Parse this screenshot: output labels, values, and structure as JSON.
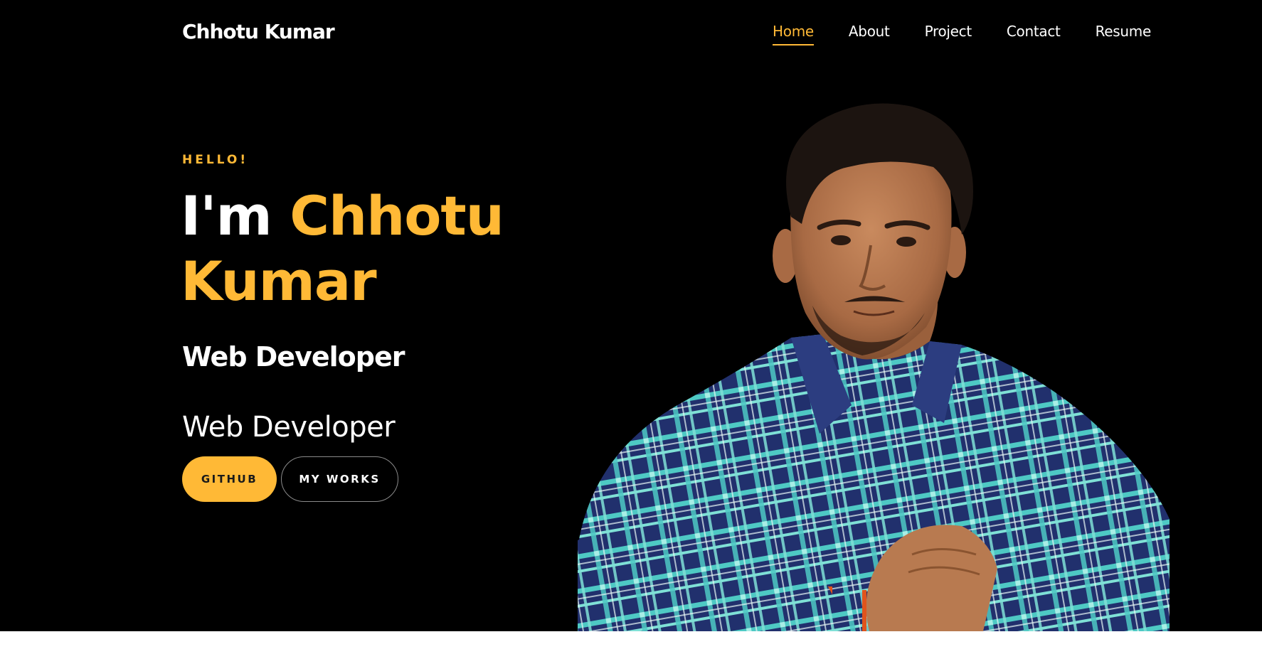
{
  "nav": {
    "brand": "Chhotu Kumar",
    "links": [
      "Home",
      "About",
      "Project",
      "Contact",
      "Resume"
    ],
    "active": "Home"
  },
  "hero": {
    "greeting": "HELLO!",
    "intro": "I'm",
    "first_name": "Chhotu",
    "last_name": "Kumar",
    "role": "Web Developer",
    "typed_role": "Web Developer"
  },
  "buttons": {
    "github": "GITHUB",
    "works": "MY WORKS"
  },
  "colors": {
    "background": "#000000",
    "accent": "#ffb936",
    "text": "#ffffff"
  },
  "portrait": {
    "icon": "person-photo"
  }
}
